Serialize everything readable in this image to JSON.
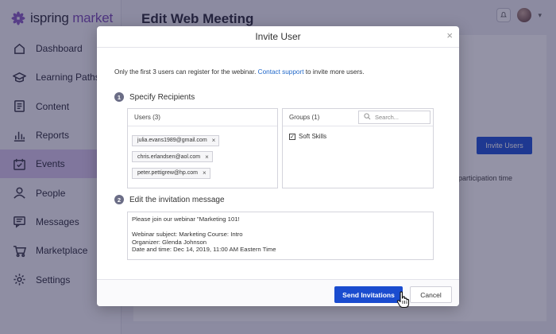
{
  "brand": {
    "name_part1": "ispring",
    "name_part2": "market"
  },
  "page": {
    "title": "Edit Web Meeting"
  },
  "sidebar": {
    "items": [
      {
        "label": "Dashboard",
        "icon": "home-icon"
      },
      {
        "label": "Learning Paths",
        "icon": "graduation-cap-icon"
      },
      {
        "label": "Content",
        "icon": "document-icon"
      },
      {
        "label": "Reports",
        "icon": "bar-chart-icon"
      },
      {
        "label": "Events",
        "icon": "calendar-check-icon",
        "active": true
      },
      {
        "label": "People",
        "icon": "person-icon"
      },
      {
        "label": "Messages",
        "icon": "message-icon"
      },
      {
        "label": "Marketplace",
        "icon": "cart-icon"
      },
      {
        "label": "Settings",
        "icon": "gear-icon"
      }
    ]
  },
  "background": {
    "invite_button": "Invite Users",
    "column_text": "ve participation time"
  },
  "modal": {
    "title": "Invite User",
    "close": "×",
    "notice_prefix": "Only the first 3 users can register for the webinar. ",
    "notice_link": "Contact support",
    "notice_suffix": " to invite more users.",
    "step1": {
      "num": "1",
      "label": "Specify Recipients"
    },
    "users": {
      "header": "Users (3)",
      "list": [
        "julia.evans1989@gmail.com",
        "chris.erlandsen@aol.com",
        "peter.pettigrew@hp.com"
      ]
    },
    "groups": {
      "header": "Groups (1)",
      "search_placeholder": "Search...",
      "items": [
        {
          "label": "Soft Skills",
          "checked": true
        }
      ]
    },
    "step2": {
      "num": "2",
      "label": "Edit the invitation message"
    },
    "message": {
      "line1": "Please join our webinar \"Marketing 101!",
      "line2": "",
      "line3": "Webinar subject: Marketing Course: Intro",
      "line4": "Organizer: Glenda Johnson",
      "line5": "Date and time: Dec 14, 2019, 11:00 AM Eastern Time"
    },
    "send_button": "Send Invitations",
    "cancel_button": "Cancel"
  },
  "colors": {
    "accent": "#1a4ccf",
    "brand_purple": "#7b4bb6",
    "active_nav": "#d8c8ee"
  }
}
